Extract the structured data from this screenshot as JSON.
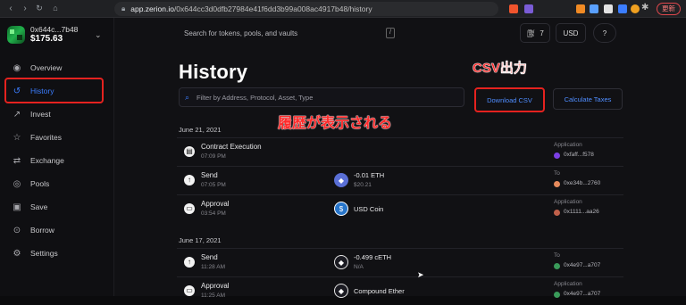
{
  "browser": {
    "url_host": "app.zerion.io",
    "url_path": "/0x644cc3d0dfb27984e41f6dd3b99a008ac4917b48/history",
    "update_label": "更新"
  },
  "wallet": {
    "address": "0x644c...7b48",
    "balance": "$175.63"
  },
  "sidebar": {
    "items": [
      {
        "label": "Overview",
        "icon": "eye-icon"
      },
      {
        "label": "History",
        "icon": "history-icon"
      },
      {
        "label": "Invest",
        "icon": "chart-icon"
      },
      {
        "label": "Favorites",
        "icon": "star-icon"
      },
      {
        "label": "Exchange",
        "icon": "exchange-icon"
      },
      {
        "label": "Pools",
        "icon": "pools-icon"
      },
      {
        "label": "Save",
        "icon": "save-icon"
      },
      {
        "label": "Borrow",
        "icon": "borrow-icon"
      },
      {
        "label": "Settings",
        "icon": "gear-icon"
      }
    ],
    "active": "History"
  },
  "topbar": {
    "search_placeholder": "Search for tokens, pools, and vaults",
    "search_shortcut": "/",
    "gas_value": "7",
    "currency": "USD"
  },
  "page": {
    "title": "History",
    "filter_placeholder": "Filter by Address, Protocol, Asset, Type",
    "download_csv_label": "Download CSV",
    "calculate_taxes_label": "Calculate Taxes"
  },
  "annotations": {
    "csv": "CSV出力",
    "history": "履歴が表示される"
  },
  "groups": [
    {
      "date": "June 21, 2021",
      "rows": [
        {
          "kind": "Contract Execution",
          "time": "07:09 PM",
          "asset": "",
          "asset_sub": "",
          "asset_icon": "",
          "party_label": "Application",
          "party": "0xfaff...f578",
          "party_color": "#7b3fe4"
        },
        {
          "kind": "Send",
          "time": "07:05 PM",
          "asset": "-0.01 ETH",
          "asset_sub": "$20.21",
          "asset_icon": "eth",
          "party_label": "To",
          "party": "0xe34b...2760",
          "party_color": "#e68a5c"
        },
        {
          "kind": "Approval",
          "time": "03:54 PM",
          "asset": "USD Coin",
          "asset_sub": "",
          "asset_icon": "usdc",
          "party_label": "Application",
          "party": "0x1111...aa26",
          "party_color": "#c0604a"
        }
      ]
    },
    {
      "date": "June 17, 2021",
      "rows": [
        {
          "kind": "Send",
          "time": "11:28 AM",
          "asset": "-0.499 cETH",
          "asset_sub": "N/A",
          "asset_icon": "ceth",
          "party_label": "To",
          "party": "0x4e97...a707",
          "party_color": "#3a9b5a"
        },
        {
          "kind": "Approval",
          "time": "11:25 AM",
          "asset": "Compound Ether",
          "asset_sub": "",
          "asset_icon": "ceth",
          "party_label": "Application",
          "party": "0x4e97...a707",
          "party_color": "#3a9b5a"
        }
      ]
    }
  ]
}
